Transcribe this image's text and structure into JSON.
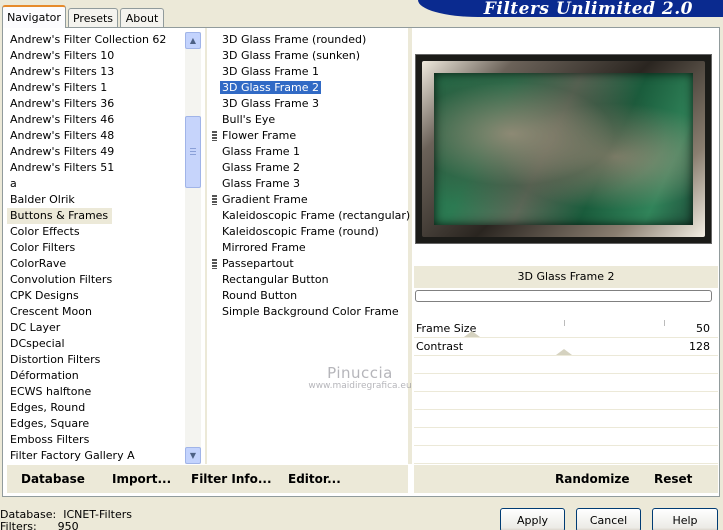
{
  "tabs": [
    {
      "label": "Navigator",
      "active": true
    },
    {
      "label": "Presets",
      "active": false
    },
    {
      "label": "About",
      "active": false
    }
  ],
  "banner": "Filters Unlimited 2.0",
  "categories": [
    "Andrew's Filter Collection 62",
    "Andrew's Filters 10",
    "Andrew's Filters 13",
    "Andrew's Filters 1",
    "Andrew's Filters 36",
    "Andrew's Filters 46",
    "Andrew's Filters 48",
    "Andrew's Filters 49",
    "Andrew's Filters 51",
    "a",
    "Balder Olrik",
    "Buttons & Frames",
    "Color Effects",
    "Color Filters",
    "ColorRave",
    "Convolution Filters",
    "CPK Designs",
    "Crescent Moon",
    "DC Layer",
    "DCspecial",
    "Distortion Filters",
    "Déformation",
    "ECWS halftone",
    "Edges, Round",
    "Edges, Square",
    "Emboss Filters",
    "Filter Factory Gallery A"
  ],
  "selected_category": "Buttons & Frames",
  "filters": [
    {
      "label": "3D Glass Frame (rounded)",
      "marker": false
    },
    {
      "label": "3D Glass Frame (sunken)",
      "marker": false
    },
    {
      "label": "3D Glass Frame 1",
      "marker": false
    },
    {
      "label": "3D Glass Frame 2",
      "marker": false
    },
    {
      "label": "3D Glass Frame 3",
      "marker": false
    },
    {
      "label": "Bull's Eye",
      "marker": false
    },
    {
      "label": "Flower Frame",
      "marker": true
    },
    {
      "label": "Glass Frame 1",
      "marker": false
    },
    {
      "label": "Glass Frame 2",
      "marker": false
    },
    {
      "label": "Glass Frame 3",
      "marker": false
    },
    {
      "label": "Gradient Frame",
      "marker": true
    },
    {
      "label": "Kaleidoscopic Frame (rectangular)",
      "marker": false
    },
    {
      "label": "Kaleidoscopic Frame (round)",
      "marker": false
    },
    {
      "label": "Mirrored Frame",
      "marker": false
    },
    {
      "label": "Passepartout",
      "marker": true
    },
    {
      "label": "Rectangular Button",
      "marker": false
    },
    {
      "label": "Round Button",
      "marker": false
    },
    {
      "label": "Simple Background Color Frame",
      "marker": false
    }
  ],
  "selected_filter": "3D Glass Frame 2",
  "preview_filter_name": "3D Glass Frame 2",
  "params": [
    {
      "label": "Frame Size",
      "value": "50"
    },
    {
      "label": "Contrast",
      "value": "128"
    }
  ],
  "bottom_left": {
    "database": "Database",
    "import": "Import...",
    "filter_info": "Filter Info...",
    "editor": "Editor..."
  },
  "bottom_right": {
    "randomize": "Randomize",
    "reset": "Reset"
  },
  "status": {
    "database_label": "Database:",
    "database_value": "ICNET-Filters",
    "filters_label": "Filters:",
    "filters_value": "950"
  },
  "buttons": {
    "apply": "Apply",
    "cancel": "Cancel",
    "help": "Help"
  },
  "watermark": {
    "line1": "Pinuccia",
    "line2": "www.maidiregrafica.eu"
  }
}
